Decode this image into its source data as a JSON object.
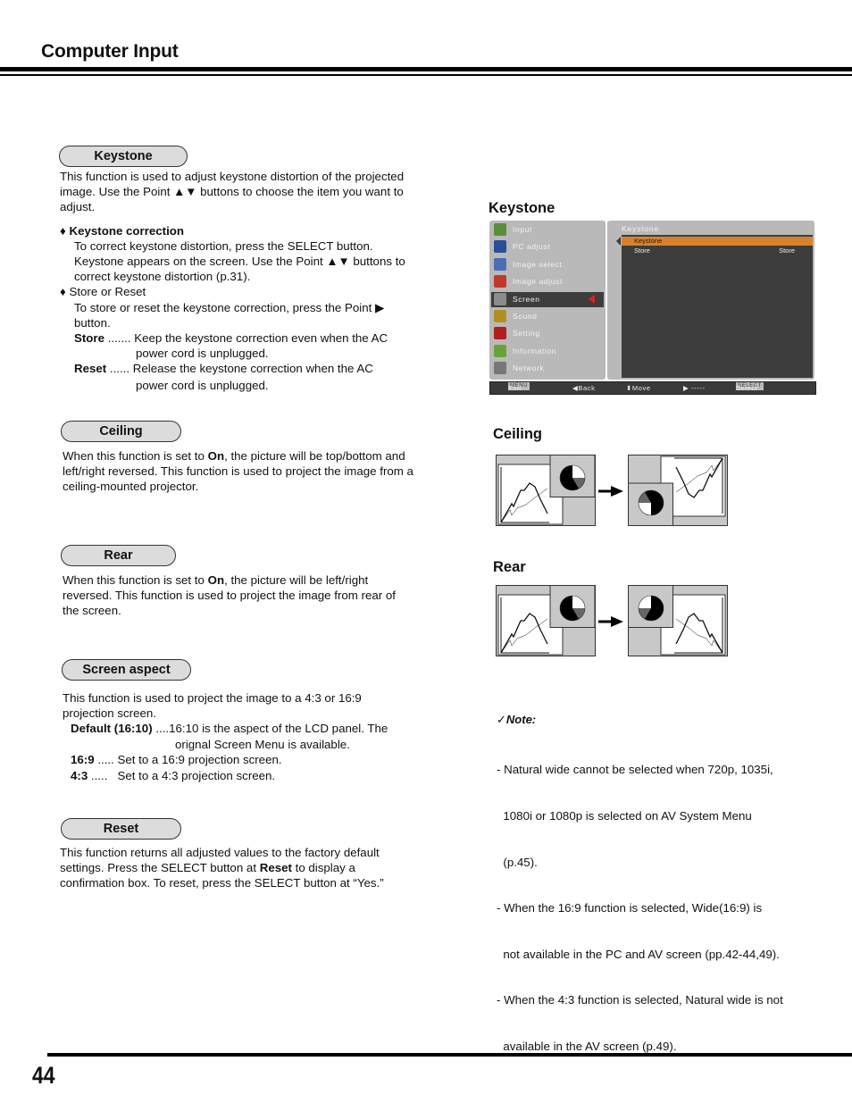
{
  "header": {
    "title": "Computer Input"
  },
  "sections": {
    "keystone": {
      "heading": "Keystone",
      "intro": [
        "This function is used to adjust keystone distortion of the  projected",
        "image. Use the Point ▲▼ buttons to choose the item you want to",
        "adjust."
      ],
      "bullet1_title": "♦ Keystone correction",
      "bullet1_lines": [
        "To correct keystone distortion, press the SELECT button.",
        "Keystone appears on the screen. Use the Point ▲▼ buttons to",
        "correct keystone distortion (p.31)."
      ],
      "bullet2_title": "♦ Store or Reset",
      "bullet2_lines": [
        "To store or reset the keystone correction, press the Point ▶",
        "button."
      ],
      "options": [
        {
          "key": "Store",
          "dots": " .......",
          "desc1": "Keep the keystone correction even when the AC",
          "desc2": "power cord is unplugged."
        },
        {
          "key": "Reset",
          "dots": " ......",
          "desc1": "Release the keystone correction when the AC",
          "desc2": "power cord is unplugged."
        }
      ]
    },
    "ceiling": {
      "heading": "Ceiling",
      "line1_pre": "When this function is set to ",
      "line1_bold": "On",
      "line1_post": ", the picture will be top/bottom and",
      "line2": "left/right reversed. This function is used to project the image from a",
      "line3": "ceiling-mounted projector."
    },
    "rear": {
      "heading": "Rear",
      "line1_pre": "When this function is set to ",
      "line1_bold": "On",
      "line1_post": ", the picture will be left/right",
      "line2": "reversed. This function is used to project the image from rear of",
      "line3": "the screen."
    },
    "screen_aspect": {
      "heading": "Screen aspect",
      "intro": [
        "This function is used to project the image to a 4:3 or 16:9",
        "projection screen."
      ],
      "options": [
        {
          "key": "Default (16:10)",
          "dots": " ....",
          "desc1": "16:10 is the aspect of the LCD panel. The",
          "desc2": "orignal Screen Menu is available."
        },
        {
          "key": "16:9",
          "dots": " ..... ",
          "desc1": "Set to a 16:9 projection screen."
        },
        {
          "key": "4:3",
          "dots": " .....   ",
          "desc1": "Set to a 4:3 projection screen."
        }
      ]
    },
    "reset": {
      "heading": "Reset",
      "line1": "This function returns all adjusted values to the factory default",
      "line2_pre": "settings. Press the SELECT button at ",
      "line2_bold": "Reset",
      "line2_post": " to display a",
      "line3": "confirmation box. To reset, press the SELECT button at “Yes.”"
    }
  },
  "figures": {
    "keystone_title": "Keystone",
    "ceiling_title": "Ceiling",
    "rear_title": "Rear"
  },
  "osd_menu": {
    "items": [
      {
        "label": "Input",
        "icon": "input-icon",
        "color": "#5a8f3a"
      },
      {
        "label": "PC adjust",
        "icon": "monitor-icon",
        "color": "#2a4f9a"
      },
      {
        "label": "Image select",
        "icon": "image-select-icon",
        "color": "#4b6fb5"
      },
      {
        "label": "Image adjust",
        "icon": "image-adjust-icon",
        "color": "#c0392b"
      },
      {
        "label": "Screen",
        "icon": "screen-icon",
        "color": "#8c8c8c"
      },
      {
        "label": "Sound",
        "icon": "speaker-icon",
        "color": "#b09020"
      },
      {
        "label": "Setting",
        "icon": "tools-icon",
        "color": "#b02020"
      },
      {
        "label": "Information",
        "icon": "info-icon",
        "color": "#6aa23a"
      },
      {
        "label": "Network",
        "icon": "network-icon",
        "color": "#777777"
      }
    ],
    "selected_index": 4,
    "panel_title": "Keystone",
    "rows": [
      {
        "label": "Keystone",
        "value": "",
        "highlight": true
      },
      {
        "label": "Store",
        "value": "Store",
        "highlight": false
      }
    ],
    "highlight_color": "#d9822b",
    "bottom_bar": [
      {
        "key": "MENU",
        "label": "Exit"
      },
      {
        "key": "",
        "label": "◀Back"
      },
      {
        "key": "",
        "label": "⬍Move"
      },
      {
        "key": "",
        "label": "▶ -----"
      },
      {
        "key": "SELECT",
        "label": "Select"
      }
    ]
  },
  "note": {
    "title": "Note:",
    "check": "✓",
    "items": [
      [
        "- Natural wide cannot be selected when 720p, 1035i,",
        "  1080i or 1080p is selected on AV System Menu",
        "  (p.45)."
      ],
      [
        "- When the 16:9 function is selected, Wide(16:9) is",
        "  not available in the PC and AV screen (pp.42-44,49)."
      ],
      [
        "- When the 4:3 function is selected, Natural wide is not",
        "  available in the AV screen (p.49)."
      ]
    ]
  },
  "footer": {
    "page_number": "44"
  }
}
